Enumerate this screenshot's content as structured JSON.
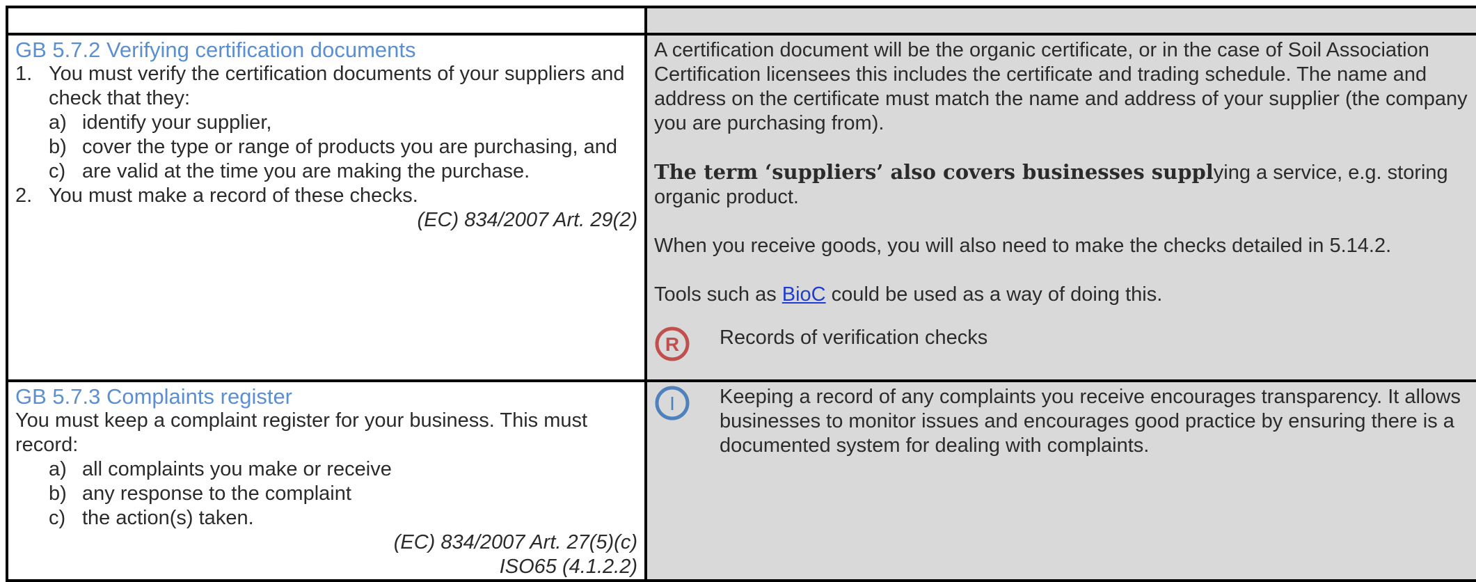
{
  "section1": {
    "heading": "GB 5.7.2 Verifying certification documents",
    "items": [
      {
        "marker": "1.",
        "text": "You must verify the certification documents of your suppliers and check that they:",
        "sub": [
          {
            "marker": "a)",
            "text": "identify your supplier,"
          },
          {
            "marker": "b)",
            "text": "cover the type or range of products you are purchasing, and"
          },
          {
            "marker": "c)",
            "text": "are valid at the time you are making the purchase."
          }
        ]
      },
      {
        "marker": "2.",
        "text": "You must make a record of these checks."
      }
    ],
    "reference": "(EC) 834/2007 Art. 29(2)",
    "guidance": {
      "p1": "A certification document will be the organic certificate, or in the case of Soil Association Certification licensees this includes the certificate and trading schedule. The name and address on the certificate must match the name and address of your supplier (the company you are purchasing from).",
      "p2_bold": "The term ‘suppliers’ also covers businesses suppl",
      "p2_rest": "ying a service, e.g. storing organic product.",
      "p3": "When you receive goods, you will also need to make the checks detailed in 5.14.2.",
      "p4_before": "Tools such as ",
      "p4_link": "BioC",
      "p4_after": " could be used as a way of doing this.",
      "record_icon_letter": "R",
      "record_text": "Records of verification checks"
    }
  },
  "section2": {
    "heading": "GB 5.7.3 Complaints register",
    "intro": "You must keep a complaint register for your business. This must record:",
    "sub": [
      {
        "marker": "a)",
        "text": "all complaints you make or receive"
      },
      {
        "marker": "b)",
        "text": "any response to the complaint"
      },
      {
        "marker": "c)",
        "text": "the action(s) taken."
      }
    ],
    "references": [
      "(EC) 834/2007 Art. 27(5)(c)",
      "ISO65 (4.1.2.2)"
    ],
    "guidance": {
      "info_icon_letter": "I",
      "info_text": "Keeping a record of any complaints you receive encourages transparency. It allows businesses to monitor issues and encourages good practice by ensuring there is a documented system for dealing with complaints."
    }
  },
  "colors": {
    "heading": "#5b8fd0",
    "grey_cell": "#d9d9d9",
    "record_icon": "#c0504d",
    "info_icon": "#4f81bd",
    "link": "#1f3ecf"
  }
}
